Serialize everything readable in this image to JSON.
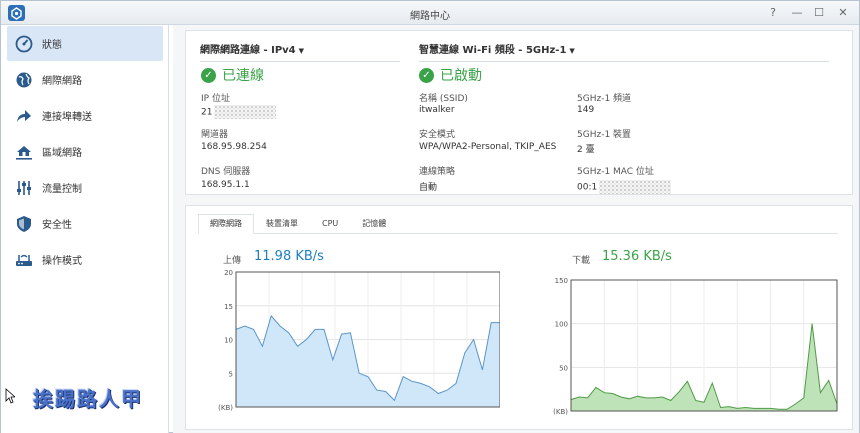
{
  "window": {
    "title": "網路中心",
    "controls": [
      "?",
      "—",
      "☐",
      "✕"
    ]
  },
  "sidebar": {
    "items": [
      {
        "label": "狀態",
        "icon": "gauge-icon",
        "active": true
      },
      {
        "label": "網際網路",
        "icon": "globe-icon",
        "active": false
      },
      {
        "label": "連接埠轉送",
        "icon": "forward-arrow-icon",
        "active": false
      },
      {
        "label": "區域網路",
        "icon": "home-network-icon",
        "active": false
      },
      {
        "label": "流量控制",
        "icon": "sliders-icon",
        "active": false
      },
      {
        "label": "安全性",
        "icon": "shield-icon",
        "active": false
      },
      {
        "label": "操作模式",
        "icon": "router-icon",
        "active": false
      }
    ]
  },
  "watermark": "挨踢路人甲",
  "internet": {
    "header": "網際網路連線 - IPv4",
    "status": "已連線",
    "ip_label": "IP 位址",
    "ip_value": "21",
    "gateway_label": "閘道器",
    "gateway_value": "168.95.98.254",
    "dns_label": "DNS 伺服器",
    "dns_value": "168.95.1.1"
  },
  "wifi": {
    "header": "智慧連線 Wi-Fi 頻段 - 5GHz-1",
    "status": "已啟動",
    "ssid_label": "名稱 (SSID)",
    "ssid_value": "itwalker",
    "security_label": "安全模式",
    "security_value": "WPA/WPA2-Personal, TKIP_AES",
    "policy_label": "連線策略",
    "policy_value": "自動",
    "channel_label": "5GHz-1 頻道",
    "channel_value": "149",
    "devices_label": "5GHz-1 裝置",
    "devices_value": "2 臺",
    "mac_label": "5GHz-1 MAC 位址",
    "mac_value": "00:1"
  },
  "tabs": [
    "網際網路",
    "裝置清單",
    "CPU",
    "記憶體"
  ],
  "upload": {
    "label": "上傳",
    "value": "11.98 KB/s"
  },
  "download": {
    "label": "下載",
    "value": "15.36 KB/s"
  },
  "colors": {
    "accent": "#1e7fbf",
    "green": "#3aa349",
    "upload_fill": "#cfe7f8",
    "download_fill": "#bfe3b8"
  },
  "chart_data": [
    {
      "type": "area",
      "ylim": [
        0,
        20
      ],
      "yticks": [
        "20",
        "15",
        "10",
        "5",
        "(KB)"
      ],
      "y": [
        11.5,
        12,
        11.5,
        9,
        13.5,
        12,
        11,
        9,
        10,
        11.5,
        11.5,
        7,
        10.8,
        11,
        5,
        4.5,
        2.5,
        2.3,
        1,
        4.5,
        3.8,
        3.5,
        3,
        2,
        2.5,
        3.5,
        8,
        10,
        5.5,
        12.5,
        12.5
      ]
    },
    {
      "type": "area",
      "ylim": [
        0,
        150
      ],
      "yticks": [
        "150",
        "100",
        "50",
        "(KB)"
      ],
      "y": [
        13,
        16,
        15,
        27,
        21,
        20,
        16,
        14,
        17,
        15,
        15,
        16,
        12,
        22,
        34,
        12,
        10,
        32,
        4,
        5,
        3,
        4,
        3,
        3,
        3,
        2,
        2,
        8,
        15,
        100,
        21,
        35,
        8
      ]
    }
  ]
}
